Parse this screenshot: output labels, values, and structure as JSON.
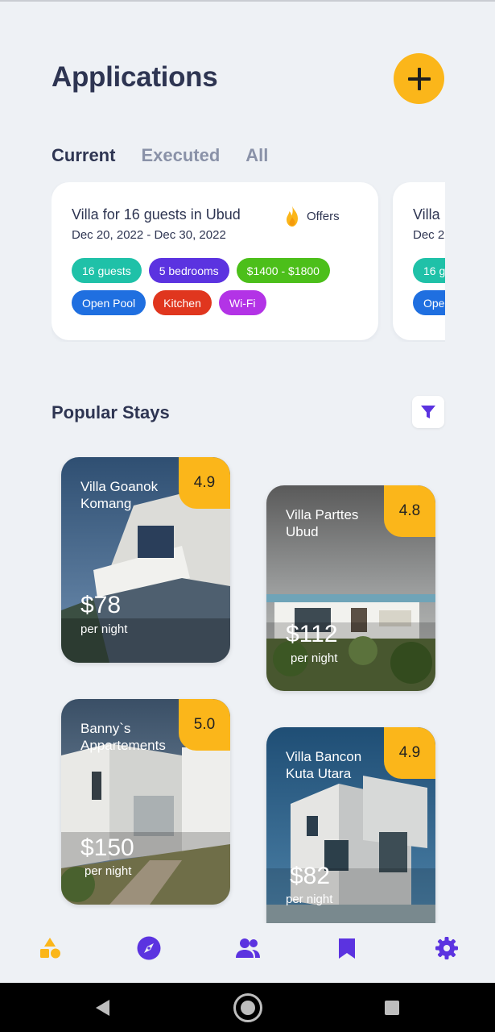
{
  "header": {
    "title": "Applications"
  },
  "tabs": [
    {
      "label": "Current"
    },
    {
      "label": "Executed"
    },
    {
      "label": "All"
    }
  ],
  "applications": [
    {
      "title": "Villa for 16 guests in Ubud",
      "dates": "Dec 20, 2022 - Dec 30, 2022",
      "offers_label": "Offers",
      "tags": [
        {
          "label": "16 guests",
          "color": "#1fc1a8"
        },
        {
          "label": "5 bedrooms",
          "color": "#5b33e0"
        },
        {
          "label": "$1400 - $1800",
          "color": "#4cbf1a"
        },
        {
          "label": "Open Pool",
          "color": "#1f6fe0"
        },
        {
          "label": "Kitchen",
          "color": "#e0361e"
        },
        {
          "label": "Wi-Fi",
          "color": "#b333e6"
        }
      ]
    },
    {
      "title": "Villa",
      "dates": "Dec 2",
      "tags": [
        {
          "label": "16 g",
          "color": "#1fc1a8"
        },
        {
          "label": "Ope",
          "color": "#1f6fe0"
        }
      ]
    }
  ],
  "popular": {
    "title": "Popular Stays",
    "stays": [
      {
        "name": "Villa Goanok Komang",
        "rating": "4.9",
        "price": "$78",
        "per": "per night"
      },
      {
        "name": "Villa Parttes Ubud",
        "rating": "4.8",
        "price": "$112",
        "per": "per night"
      },
      {
        "name": "Banny`s Appartements",
        "rating": "5.0",
        "price": "$150",
        "per": "per night"
      },
      {
        "name": "Villa Bancon Kuta Utara",
        "rating": "4.9",
        "price": "$82",
        "per": "per night"
      }
    ]
  },
  "colors": {
    "accent": "#fbb61a",
    "primary": "#5b33e0",
    "text": "#2e3552",
    "muted": "#8a92a8",
    "background": "#eef1f5"
  },
  "bottom_nav": [
    {
      "icon": "shapes-icon",
      "active": true
    },
    {
      "icon": "compass-icon",
      "active": false
    },
    {
      "icon": "people-icon",
      "active": false
    },
    {
      "icon": "bookmark-icon",
      "active": false
    },
    {
      "icon": "gear-icon",
      "active": false
    }
  ],
  "system_nav": [
    {
      "icon": "back-triangle-icon"
    },
    {
      "icon": "home-circle-icon"
    },
    {
      "icon": "recents-square-icon"
    }
  ]
}
